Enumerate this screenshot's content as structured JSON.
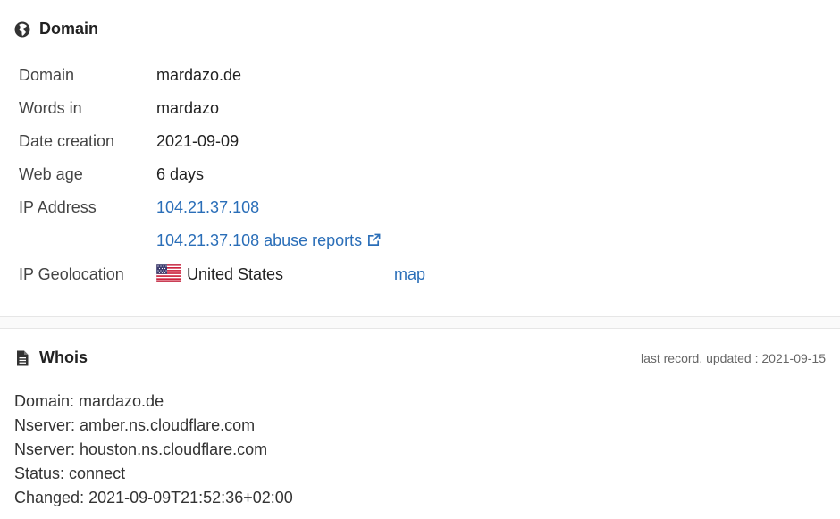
{
  "domain_section": {
    "title": "Domain",
    "icon": "globe-icon",
    "rows": {
      "domain": {
        "label": "Domain",
        "value": "mardazo.de"
      },
      "words": {
        "label": "Words in",
        "value": "mardazo"
      },
      "date_creation": {
        "label": "Date creation",
        "value": "2021-09-09"
      },
      "web_age": {
        "label": "Web age",
        "value": "6 days"
      },
      "ip_address": {
        "label": "IP Address",
        "value": "104.21.37.108"
      },
      "abuse": {
        "value": "104.21.37.108 abuse reports",
        "icon": "external-link-icon"
      },
      "geolocation": {
        "label": "IP Geolocation",
        "country": "United States",
        "flag": "us-flag-icon",
        "map_label": "map"
      }
    }
  },
  "whois_section": {
    "title": "Whois",
    "icon": "document-icon",
    "updated": "last record, updated : 2021-09-15",
    "lines": [
      "Domain: mardazo.de",
      "Nserver: amber.ns.cloudflare.com",
      "Nserver: houston.ns.cloudflare.com",
      "Status: connect",
      "Changed: 2021-09-09T21:52:36+02:00"
    ]
  },
  "colors": {
    "link": "#2a6eb8",
    "text": "#333333",
    "separator": "#fafafa"
  }
}
